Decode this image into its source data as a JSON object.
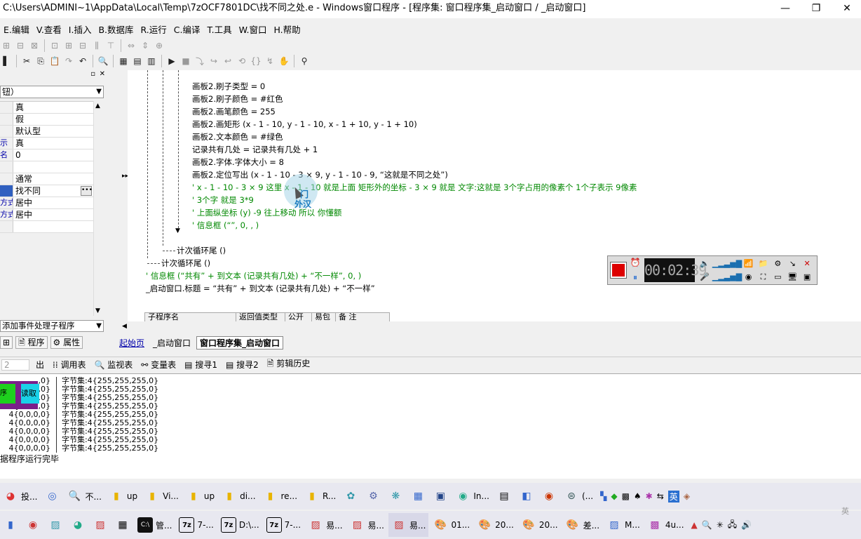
{
  "window": {
    "title": "C:\\Users\\ADMINI~1\\AppData\\Local\\Temp\\7zOCF7801DC\\找不同之处.e - Windows窗口程序 - [程序集: 窗口程序集_启动窗口 / _启动窗口]",
    "minimize": "—",
    "maximize": "❐",
    "close": "✕"
  },
  "menu": [
    "E.编辑",
    "V.查看",
    "I.插入",
    "B.数据库",
    "R.运行",
    "C.编译",
    "T.工具",
    "W.窗口",
    "H.帮助"
  ],
  "left_panel": {
    "combo": "钮）",
    "props": [
      {
        "key": "",
        "value": "真"
      },
      {
        "key": "",
        "value": "假"
      },
      {
        "key": "",
        "value": "默认型"
      },
      {
        "key": "示",
        "value": "真"
      },
      {
        "key": "名",
        "value": "0"
      },
      {
        "key": "",
        "value": ""
      },
      {
        "key": "",
        "value": "通常"
      },
      {
        "key": "",
        "value": "找不同",
        "selected": true
      },
      {
        "key": "方式",
        "value": "居中"
      },
      {
        "key": "方式",
        "value": "居中"
      },
      {
        "key": "",
        "value": ""
      }
    ],
    "event_combo": "添加事件处理子程序",
    "tab_program": "程序",
    "tab_property": "属性"
  },
  "code_lines": [
    {
      "text": "画板2.刷子类型 = 0",
      "color": "blk"
    },
    {
      "text": "画板2.刷子颜色 = #红色",
      "color": "blk"
    },
    {
      "text": "画板2.画笔颜色 = 255",
      "color": "blk"
    },
    {
      "text": "画板2.画矩形 (x - 1 - 10, y - 1 - 10, x - 1 + 10, y - 1 + 10)",
      "color": "blk"
    },
    {
      "text": "画板2.文本颜色 = #绿色",
      "color": "blk"
    },
    {
      "text": "记录共有几处 = 记录共有几处 + 1",
      "color": "blk"
    },
    {
      "text": "画板2.字体.字体大小 = 8",
      "color": "blk"
    },
    {
      "text": "画板2.定位写出 (x - 1 - 10 - 3 × 9, y - 1 - 10 - 9, “这就是不同之处”)",
      "color": "blk"
    },
    {
      "text": "' x - 1 - 10 - 3 × 9  这里  x - 1 - 10 就是上面 矩形外的坐标   - 3 × 9   就是    文字:这就是 3个字占用的像素个 1个子表示 9像素",
      "color": "grn"
    },
    {
      "text": "' 3个字 就是 3*9",
      "color": "grn"
    },
    {
      "text": "' 上面纵坐标 (y)  -9 往上移动 所以 你懂额",
      "color": "grn"
    },
    {
      "text": "' 信息框 (“”, 0, , )",
      "color": "grn"
    }
  ],
  "loop_end_inner": "计次循环尾 ()",
  "loop_end_outer": "计次循环尾 ()",
  "after_lines": [
    {
      "text": "' 信息框 (“共有” + 到文本 (记录共有几处) + “不一样”, 0, )",
      "color": "grn"
    },
    {
      "text": "_启动窗口.标题 = “共有” + 到文本 (记录共有几处) + “不一样”",
      "color": "blk"
    }
  ],
  "sub_table_headers": [
    "子程序名",
    "返回值类型",
    "公开",
    "易包",
    "备 注"
  ],
  "doc_tabs": [
    "起始页",
    "_启动窗口",
    "窗口程序集_启动窗口"
  ],
  "recorder": {
    "time": "00:02:39"
  },
  "watermark": {
    "line1": "门",
    "line2": "外汉"
  },
  "bottom_tabs": [
    "2",
    "出",
    "调用表",
    "监视表",
    "变量表",
    "搜寻1",
    "搜寻2",
    "剪辑历史"
  ],
  "output_left": [
    ",0}",
    ",0}",
    ".0}",
    "4{0,0,0,0}",
    "4{0,0,0,0}",
    "4{0,0,0,0}",
    "4{0,0,0,0}",
    "4{0,0,0,0}",
    "4{0,0,0,0}"
  ],
  "output_right": [
    "字节集:4{255,255,255,0}",
    "字节集:4{255,255,255,0}",
    "字节集:4{255,255,255,0}",
    "字节集:4{255,255,255,0}",
    "字节集:4{255,255,255,0}",
    "字节集:4{255,255,255,0}",
    "字节集:4{255,255,255,0}",
    "字节集:4{255,255,255,0}",
    "字节集:4{255,255,255,0}"
  ],
  "overlay": {
    "green": "序",
    "cyan": "读取"
  },
  "output_done": "据程序运行完毕",
  "taskbar1": [
    "投...",
    "",
    "不...",
    "up",
    "Vi...",
    "up",
    "di...",
    "re...",
    "R...",
    "",
    "",
    "",
    "",
    "",
    "In...",
    "",
    "",
    "",
    "(..."
  ],
  "taskbar2": [
    "",
    "",
    "",
    "",
    "",
    "管...",
    "7-...",
    "D:\\...",
    "7-...",
    "易...",
    "易...",
    "易...",
    "01...",
    "20...",
    "20...",
    "差...",
    "M...",
    "4u..."
  ],
  "tray": {
    "ime": "英",
    "ime2": "英"
  }
}
